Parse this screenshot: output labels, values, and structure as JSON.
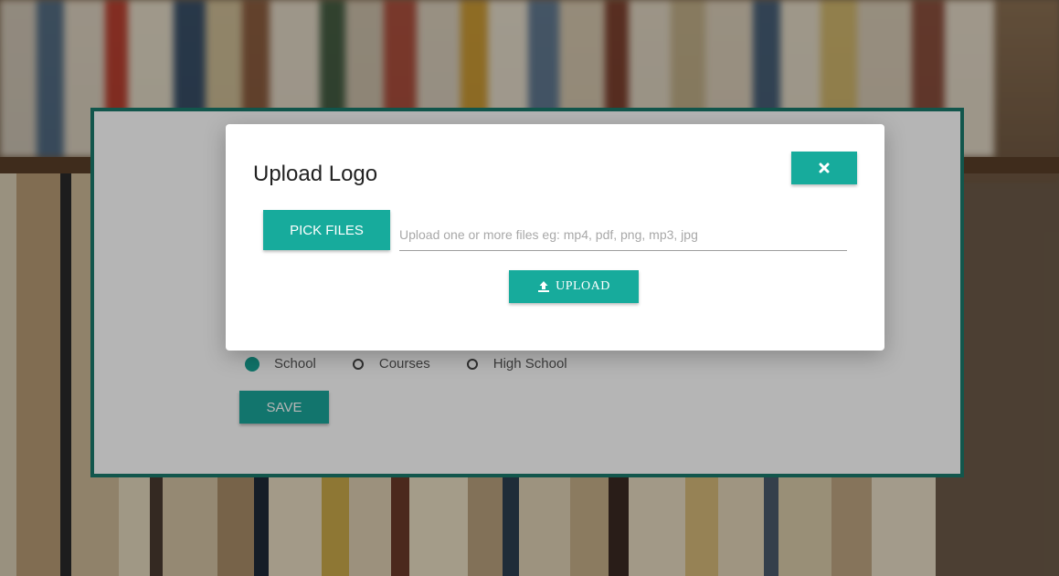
{
  "modal": {
    "title": "Upload Logo",
    "close_icon": "close-icon",
    "pick_files_label": "PICK FILES",
    "file_input_placeholder": "Upload one or more files eg: mp4, pdf, png, mp3, jpg",
    "file_input_value": "",
    "upload_label": "UPLOAD",
    "upload_icon": "upload-icon"
  },
  "form": {
    "radios": [
      {
        "label": "School",
        "checked": true
      },
      {
        "label": "Courses",
        "checked": false
      },
      {
        "label": "High School",
        "checked": false
      }
    ],
    "save_label": "SAVE"
  },
  "colors": {
    "accent": "#17ab9c",
    "card_border": "#1a7a6c",
    "overlay": "rgba(0,0,0,0.29)"
  }
}
